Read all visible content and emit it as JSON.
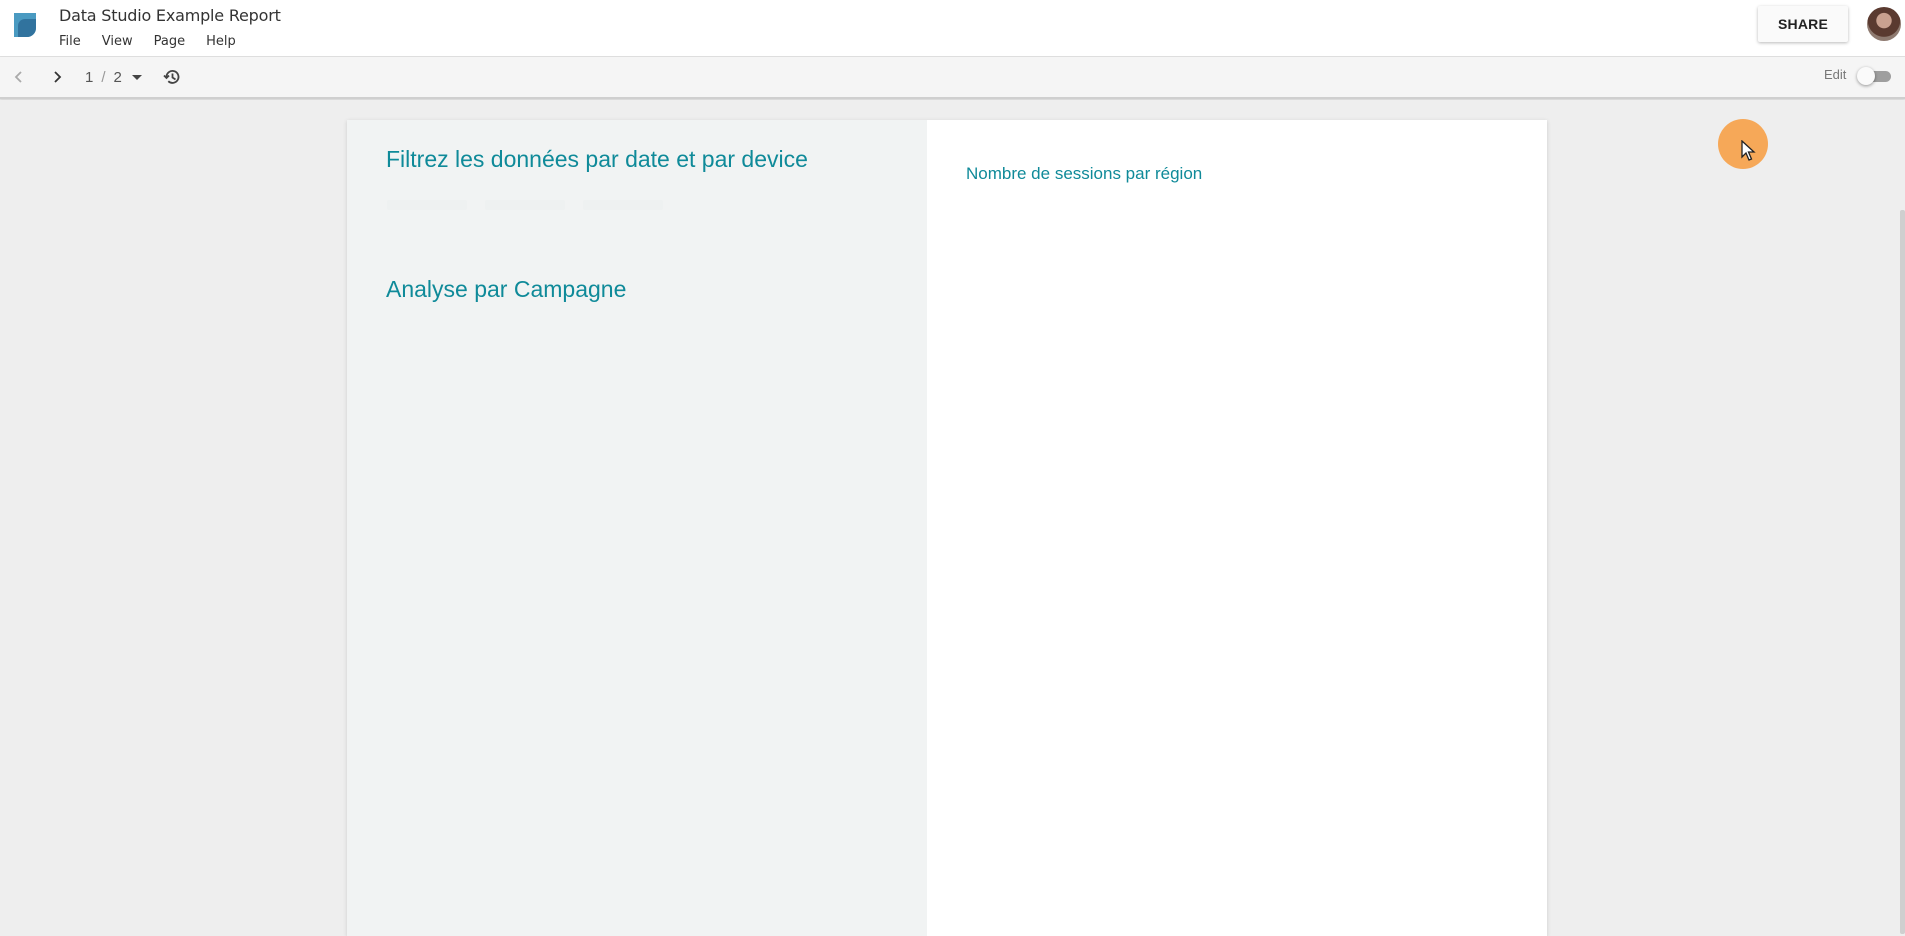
{
  "app": {
    "title": "Data Studio Example Report",
    "menu": [
      "File",
      "View",
      "Page",
      "Help"
    ],
    "share_label": "SHARE",
    "accent_color": "#0f8a99"
  },
  "toolbar": {
    "current_page": "1",
    "separator": "/",
    "total_pages": "2",
    "edit_label": "Edit",
    "edit_mode_on": false
  },
  "report": {
    "left_heading": "Filtrez les données par date et par device",
    "campaign_heading": "Analyse par Campagne",
    "chart_title": "Nombre de sessions par région"
  },
  "icons": {
    "logo": "data-studio-logo-icon",
    "prev": "chevron-left-icon",
    "next": "chevron-right-icon",
    "dropdown": "caret-down-icon",
    "history": "history-icon",
    "avatar": "user-avatar"
  }
}
